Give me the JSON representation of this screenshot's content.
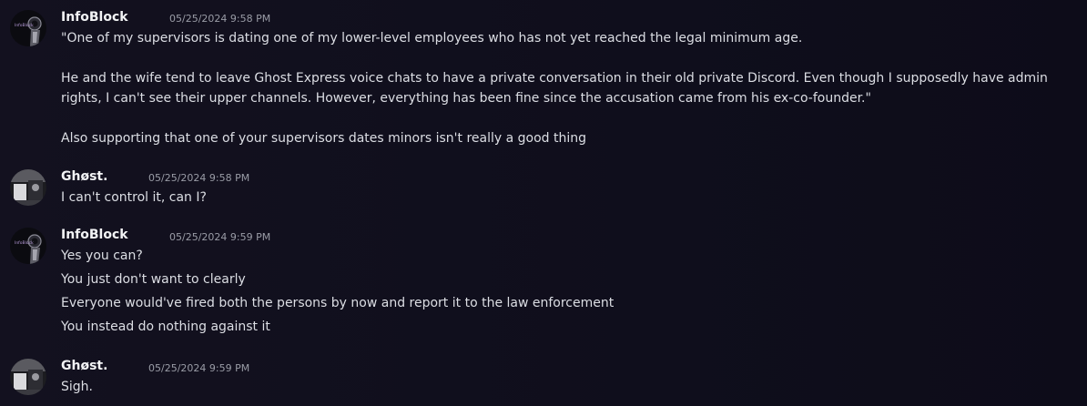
{
  "messages": [
    {
      "author": "InfoBlock",
      "timestamp": "05/25/2024 9:58 PM",
      "avatar_text": "InfoBlock",
      "lines": [
        "\"One of my supervisors is dating one of my lower-level employees who has not yet reached the legal minimum age.",
        "He and the wife tend to leave Ghost Express voice chats to have a private conversation in their old private Discord. Even though I supposedly have admin rights, I can't see their upper channels. However, everything has been fine since the accusation came from his ex-co-founder.\"",
        "Also supporting that one of your supervisors dates minors isn't really a good thing"
      ]
    },
    {
      "author": "Ghøst.",
      "timestamp": "05/25/2024 9:58 PM",
      "lines": [
        "I can't control it, can I?"
      ]
    },
    {
      "author": "InfoBlock",
      "timestamp": "05/25/2024 9:59 PM",
      "avatar_text": "InfoBlock",
      "lines": [
        "Yes you can?",
        "You just don't want to clearly",
        "Everyone would've fired both the persons by now and report it to the law enforcement",
        "You instead do nothing against it"
      ]
    },
    {
      "author": "Ghøst.",
      "timestamp": "05/25/2024 9:59 PM",
      "lines": [
        "Sigh."
      ]
    }
  ]
}
